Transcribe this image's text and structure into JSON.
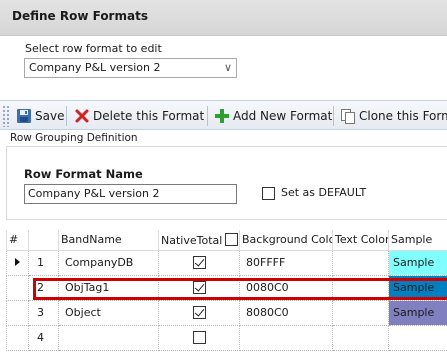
{
  "header": {
    "title": "Define Row Formats"
  },
  "selector": {
    "label": "Select row format to edit",
    "value": "Company P&L version 2",
    "chevron": "∨"
  },
  "toolbar": {
    "save_label": "Save",
    "delete_label": "Delete this Format",
    "add_label": "Add New Format",
    "clone_label": "Clone this Forma"
  },
  "grouping": {
    "label": "Row Grouping Definition",
    "name_label": "Row Format Name",
    "name_value": "Company P&L version 2",
    "default_label": "Set as DEFAULT",
    "default_checked": false
  },
  "grid": {
    "headers": {
      "num": "#",
      "band": "BandName",
      "native": "NativeTotal",
      "bg": "Background Color",
      "text": "Text Color",
      "sample": "Sample"
    },
    "rows": [
      {
        "num": "1",
        "band": "CompanyDB",
        "native": true,
        "bg": "80FFFF",
        "text": "",
        "sample": "Sample",
        "sample_bg": "#80FFFF",
        "current": true
      },
      {
        "num": "2",
        "band": "ObjTag1",
        "native": true,
        "bg": "0080C0",
        "text": "",
        "sample": "Sample",
        "sample_bg": "#0080C0",
        "current": false,
        "highlighted": true
      },
      {
        "num": "3",
        "band": "Object",
        "native": true,
        "bg": "8080C0",
        "text": "",
        "sample": "Sample",
        "sample_bg": "#8080C0",
        "current": false
      },
      {
        "num": "4",
        "band": "",
        "native": false,
        "bg": "",
        "text": "",
        "sample": "",
        "sample_bg": "",
        "current": false
      }
    ]
  },
  "colors": {
    "highlight": "#D00000",
    "toolbar_bg": "#E6EBF2",
    "delete_icon": "#D62020",
    "add_icon": "#2EA02E"
  },
  "icons": {
    "save": "save-disk-icon",
    "delete": "red-x-icon",
    "add": "green-plus-icon",
    "clone": "clone-pages-icon",
    "current_row": "row-pointer-icon"
  }
}
